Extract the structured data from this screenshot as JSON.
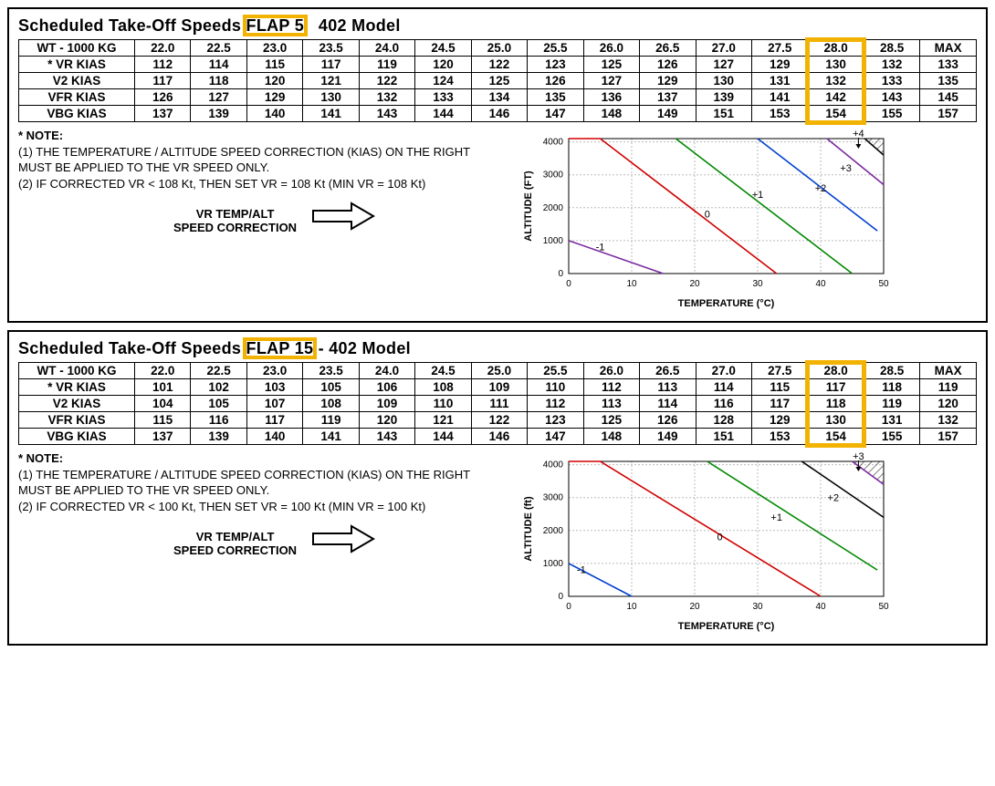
{
  "sections": [
    {
      "title_prefix": "Scheduled Take-Off Speeds ",
      "flap_label": "FLAP 5",
      "title_suffix": "   402 Model",
      "table": {
        "header_label": "WT - 1000 KG",
        "columns": [
          "22.0",
          "22.5",
          "23.0",
          "23.5",
          "24.0",
          "24.5",
          "25.0",
          "25.5",
          "26.0",
          "26.5",
          "27.0",
          "27.5",
          "28.0",
          "28.5",
          "MAX"
        ],
        "rows": [
          {
            "label": "* VR KIAS",
            "values": [
              "112",
              "114",
              "115",
              "117",
              "119",
              "120",
              "122",
              "123",
              "125",
              "126",
              "127",
              "129",
              "130",
              "132",
              "133"
            ]
          },
          {
            "label": "V2 KIAS",
            "values": [
              "117",
              "118",
              "120",
              "121",
              "122",
              "124",
              "125",
              "126",
              "127",
              "129",
              "130",
              "131",
              "132",
              "133",
              "135"
            ]
          },
          {
            "label": "VFR KIAS",
            "values": [
              "126",
              "127",
              "129",
              "130",
              "132",
              "133",
              "134",
              "135",
              "136",
              "137",
              "139",
              "141",
              "142",
              "143",
              "145"
            ]
          },
          {
            "label": "VBG KIAS",
            "values": [
              "137",
              "139",
              "140",
              "141",
              "143",
              "144",
              "146",
              "147",
              "148",
              "149",
              "151",
              "153",
              "154",
              "155",
              "157"
            ]
          }
        ],
        "highlight_col_index": 12
      },
      "note": {
        "title": "* NOTE:",
        "l1": "(1) THE TEMPERATURE / ALTITUDE SPEED CORRECTION (KIAS) ON THE RIGHT MUST BE APPLIED TO THE VR SPEED ONLY.",
        "l2": "(2) IF CORRECTED VR < 108 Kt, THEN SET VR = 108 Kt (MIN VR = 108 Kt)",
        "corr_label1": "VR TEMP/ALT",
        "corr_label2": "SPEED CORRECTION"
      },
      "chart": {
        "ylabel": "ALTITUDE (FT)",
        "xlabel": "TEMPERATURE (°C)",
        "xticks": [
          "0",
          "10",
          "20",
          "30",
          "40",
          "50"
        ],
        "yticks": [
          "0",
          "1000",
          "2000",
          "3000",
          "4000"
        ],
        "annotations": [
          "-1",
          "0",
          "+1",
          "+2",
          "+3",
          "+4"
        ]
      }
    },
    {
      "title_prefix": "Scheduled Take-Off Speeds ",
      "flap_label": "FLAP 15",
      "title_suffix": " - 402 Model",
      "table": {
        "header_label": "WT - 1000 KG",
        "columns": [
          "22.0",
          "22.5",
          "23.0",
          "23.5",
          "24.0",
          "24.5",
          "25.0",
          "25.5",
          "26.0",
          "26.5",
          "27.0",
          "27.5",
          "28.0",
          "28.5",
          "MAX"
        ],
        "rows": [
          {
            "label": "* VR KIAS",
            "values": [
              "101",
              "102",
              "103",
              "105",
              "106",
              "108",
              "109",
              "110",
              "112",
              "113",
              "114",
              "115",
              "117",
              "118",
              "119"
            ]
          },
          {
            "label": "V2 KIAS",
            "values": [
              "104",
              "105",
              "107",
              "108",
              "109",
              "110",
              "111",
              "112",
              "113",
              "114",
              "116",
              "117",
              "118",
              "119",
              "120"
            ]
          },
          {
            "label": "VFR KIAS",
            "values": [
              "115",
              "116",
              "117",
              "119",
              "120",
              "121",
              "122",
              "123",
              "125",
              "126",
              "128",
              "129",
              "130",
              "131",
              "132"
            ]
          },
          {
            "label": "VBG KIAS",
            "values": [
              "137",
              "139",
              "140",
              "141",
              "143",
              "144",
              "146",
              "147",
              "148",
              "149",
              "151",
              "153",
              "154",
              "155",
              "157"
            ]
          }
        ],
        "highlight_col_index": 12
      },
      "note": {
        "title": "* NOTE:",
        "l1": "(1) THE TEMPERATURE / ALTITUDE SPEED CORRECTION (KIAS) ON THE RIGHT MUST BE APPLIED TO THE VR SPEED ONLY.",
        "l2": "(2) IF CORRECTED VR < 100 Kt, THEN SET VR = 100 Kt (MIN VR = 100 Kt)",
        "corr_label1": "VR TEMP/ALT",
        "corr_label2": "SPEED CORRECTION"
      },
      "chart": {
        "ylabel": "ALTITUDE (ft)",
        "xlabel": "TEMPERATURE (°C)",
        "xticks": [
          "0",
          "10",
          "20",
          "30",
          "40",
          "50"
        ],
        "yticks": [
          "0",
          "1000",
          "2000",
          "3000",
          "4000"
        ],
        "annotations": [
          "-1",
          "0",
          "+1",
          "+2",
          "+3"
        ]
      }
    }
  ],
  "chart_data": [
    {
      "type": "line",
      "title": "VR Temp/Alt Speed Correction FLAP 5",
      "xlabel": "TEMPERATURE (°C)",
      "ylabel": "ALTITUDE (FT)",
      "xlim": [
        0,
        50
      ],
      "ylim": [
        0,
        4100
      ],
      "series": [
        {
          "name": "-1",
          "color": "#7a2aa0",
          "points": [
            [
              0,
              1000
            ],
            [
              15,
              0
            ]
          ]
        },
        {
          "name": "0",
          "color": "#d00000",
          "points": [
            [
              0,
              4100
            ],
            [
              5,
              4100
            ],
            [
              33,
              0
            ]
          ]
        },
        {
          "name": "+1",
          "color": "#008800",
          "points": [
            [
              17,
              4100
            ],
            [
              45,
              0
            ]
          ]
        },
        {
          "name": "+2",
          "color": "#0040d0",
          "points": [
            [
              30,
              4100
            ],
            [
              49,
              1300
            ]
          ]
        },
        {
          "name": "+3",
          "color": "#7a2aa0",
          "points": [
            [
              41,
              4100
            ],
            [
              50,
              2700
            ]
          ]
        },
        {
          "name": "+4",
          "color": "#000000",
          "points": [
            [
              47,
              4100
            ],
            [
              50,
              3600
            ]
          ]
        }
      ],
      "annotation_positions": {
        "-1": [
          5,
          700
        ],
        "0": [
          22,
          1700
        ],
        "+1": [
          30,
          2300
        ],
        "+2": [
          40,
          2500
        ],
        "+3": [
          44,
          3100
        ],
        "+4": [
          46,
          4300
        ]
      }
    },
    {
      "type": "line",
      "title": "VR Temp/Alt Speed Correction FLAP 15",
      "xlabel": "TEMPERATURE (°C)",
      "ylabel": "ALTITUDE (ft)",
      "xlim": [
        0,
        50
      ],
      "ylim": [
        0,
        4100
      ],
      "series": [
        {
          "name": "-1",
          "color": "#0040d0",
          "points": [
            [
              0,
              1000
            ],
            [
              10,
              0
            ]
          ]
        },
        {
          "name": "0",
          "color": "#d00000",
          "points": [
            [
              0,
              4100
            ],
            [
              5,
              4100
            ],
            [
              40,
              0
            ]
          ]
        },
        {
          "name": "+1",
          "color": "#008800",
          "points": [
            [
              22,
              4100
            ],
            [
              49,
              800
            ]
          ]
        },
        {
          "name": "+2",
          "color": "#000000",
          "points": [
            [
              37,
              4100
            ],
            [
              50,
              2400
            ]
          ]
        },
        {
          "name": "+3",
          "color": "#7a2aa0",
          "points": [
            [
              45,
              4100
            ],
            [
              50,
              3400
            ]
          ]
        }
      ],
      "annotation_positions": {
        "-1": [
          2,
          700
        ],
        "0": [
          24,
          1700
        ],
        "+1": [
          33,
          2300
        ],
        "+2": [
          42,
          2900
        ],
        "+3": [
          46,
          4300
        ]
      }
    }
  ]
}
